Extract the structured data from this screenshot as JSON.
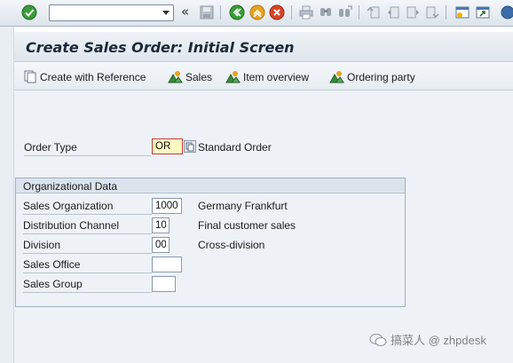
{
  "system_toolbar": {
    "command_field_value": "",
    "icons": [
      "enter-check",
      "command-field-dropdown",
      "collapse",
      "save",
      "back",
      "exit",
      "cancel",
      "print",
      "find",
      "find-next",
      "first-page",
      "previous-page",
      "next-page",
      "last-page",
      "create-session",
      "generate-shortcut",
      "help"
    ]
  },
  "title": "Create Sales Order: Initial Screen",
  "app_toolbar": {
    "create_with_reference": "Create with Reference",
    "sales": "Sales",
    "item_overview": "Item overview",
    "ordering_party": "Ordering party"
  },
  "order_type": {
    "label": "Order Type",
    "value": "OR",
    "description": "Standard Order"
  },
  "org_data": {
    "title": "Organizational Data",
    "fields": [
      {
        "label": "Sales Organization",
        "value": "1000",
        "description": "Germany Frankfurt"
      },
      {
        "label": "Distribution Channel",
        "value": "10",
        "description": "Final customer sales"
      },
      {
        "label": "Division",
        "value": "00",
        "description": "Cross-division"
      },
      {
        "label": "Sales Office",
        "value": "",
        "description": ""
      },
      {
        "label": "Sales Group",
        "value": "",
        "description": ""
      }
    ]
  },
  "watermark": "搞菜人 @ zhpdesk",
  "colors": {
    "required_border": "#c23b3b",
    "required_fill": "#fff7c0",
    "title_text": "#1a2a3a",
    "background": "#eef2f6"
  }
}
